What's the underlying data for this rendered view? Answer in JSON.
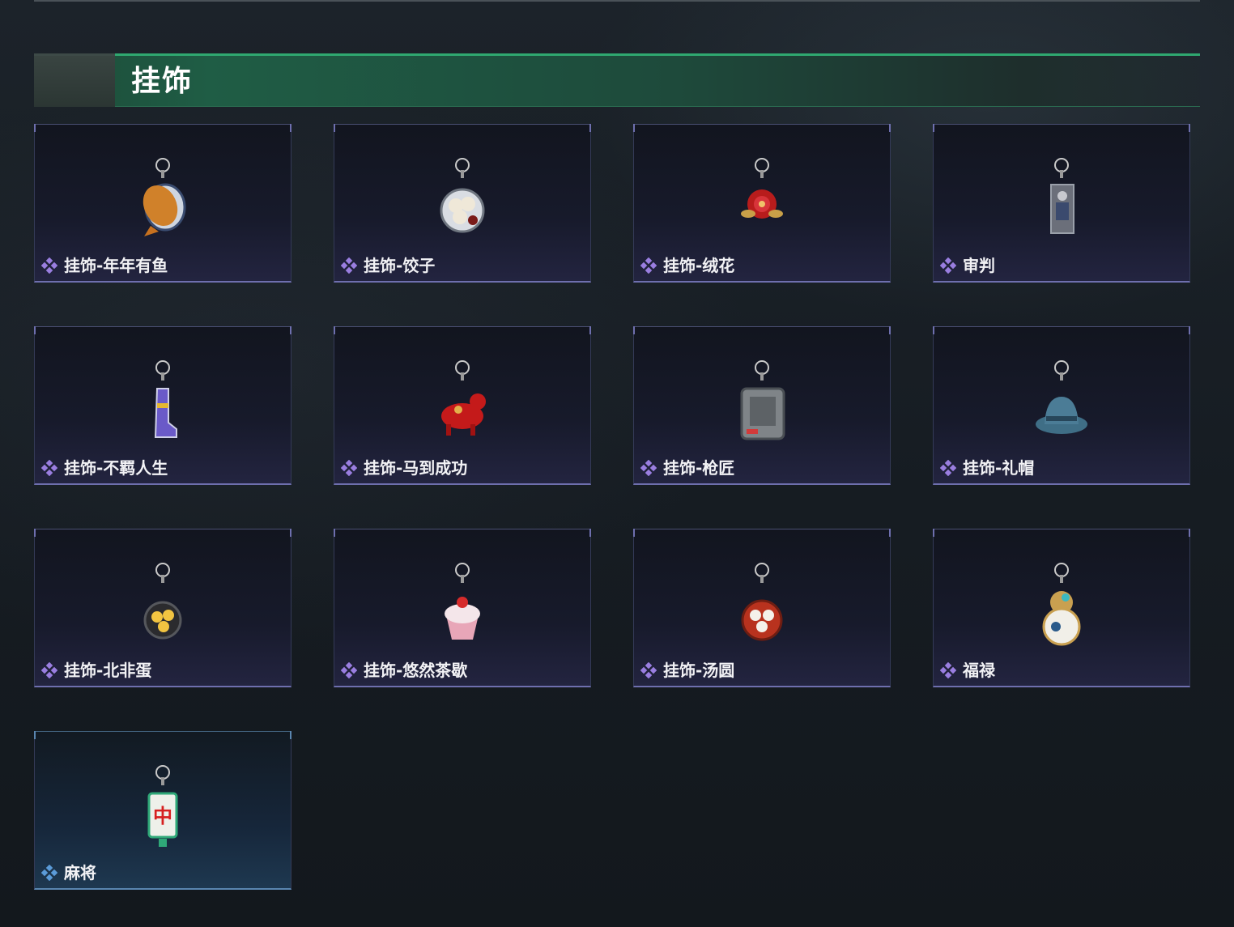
{
  "section": {
    "title": "挂饰"
  },
  "items": [
    {
      "name": "挂饰-年年有鱼",
      "icon": "fish-plate-charm-icon",
      "rarity_color": "#9a7ee0"
    },
    {
      "name": "挂饰-饺子",
      "icon": "dumpling-plate-charm-icon",
      "rarity_color": "#9a7ee0"
    },
    {
      "name": "挂饰-绒花",
      "icon": "velvet-flower-charm-icon",
      "rarity_color": "#9a7ee0"
    },
    {
      "name": "审判",
      "icon": "judgement-figure-charm-icon",
      "rarity_color": "#9a7ee0"
    },
    {
      "name": "挂饰-不羁人生",
      "icon": "sneaker-charm-icon",
      "rarity_color": "#9a7ee0"
    },
    {
      "name": "挂饰-马到成功",
      "icon": "red-horse-charm-icon",
      "rarity_color": "#9a7ee0"
    },
    {
      "name": "挂饰-枪匠",
      "icon": "gun-case-charm-icon",
      "rarity_color": "#9a7ee0"
    },
    {
      "name": "挂饰-礼帽",
      "icon": "fedora-hat-charm-icon",
      "rarity_color": "#9a7ee0"
    },
    {
      "name": "挂饰-北非蛋",
      "icon": "shakshuka-pan-charm-icon",
      "rarity_color": "#9a7ee0"
    },
    {
      "name": "挂饰-悠然茶歇",
      "icon": "cupcake-charm-icon",
      "rarity_color": "#9a7ee0"
    },
    {
      "name": "挂饰-汤圆",
      "icon": "tangyuan-bowl-charm-icon",
      "rarity_color": "#9a7ee0"
    },
    {
      "name": "福禄",
      "icon": "gourd-charm-icon",
      "rarity_color": "#9a7ee0"
    },
    {
      "name": "麻将",
      "icon": "mahjong-tile-charm-icon",
      "rarity_color": "#5b9bd8",
      "tile_text": "中"
    }
  ]
}
